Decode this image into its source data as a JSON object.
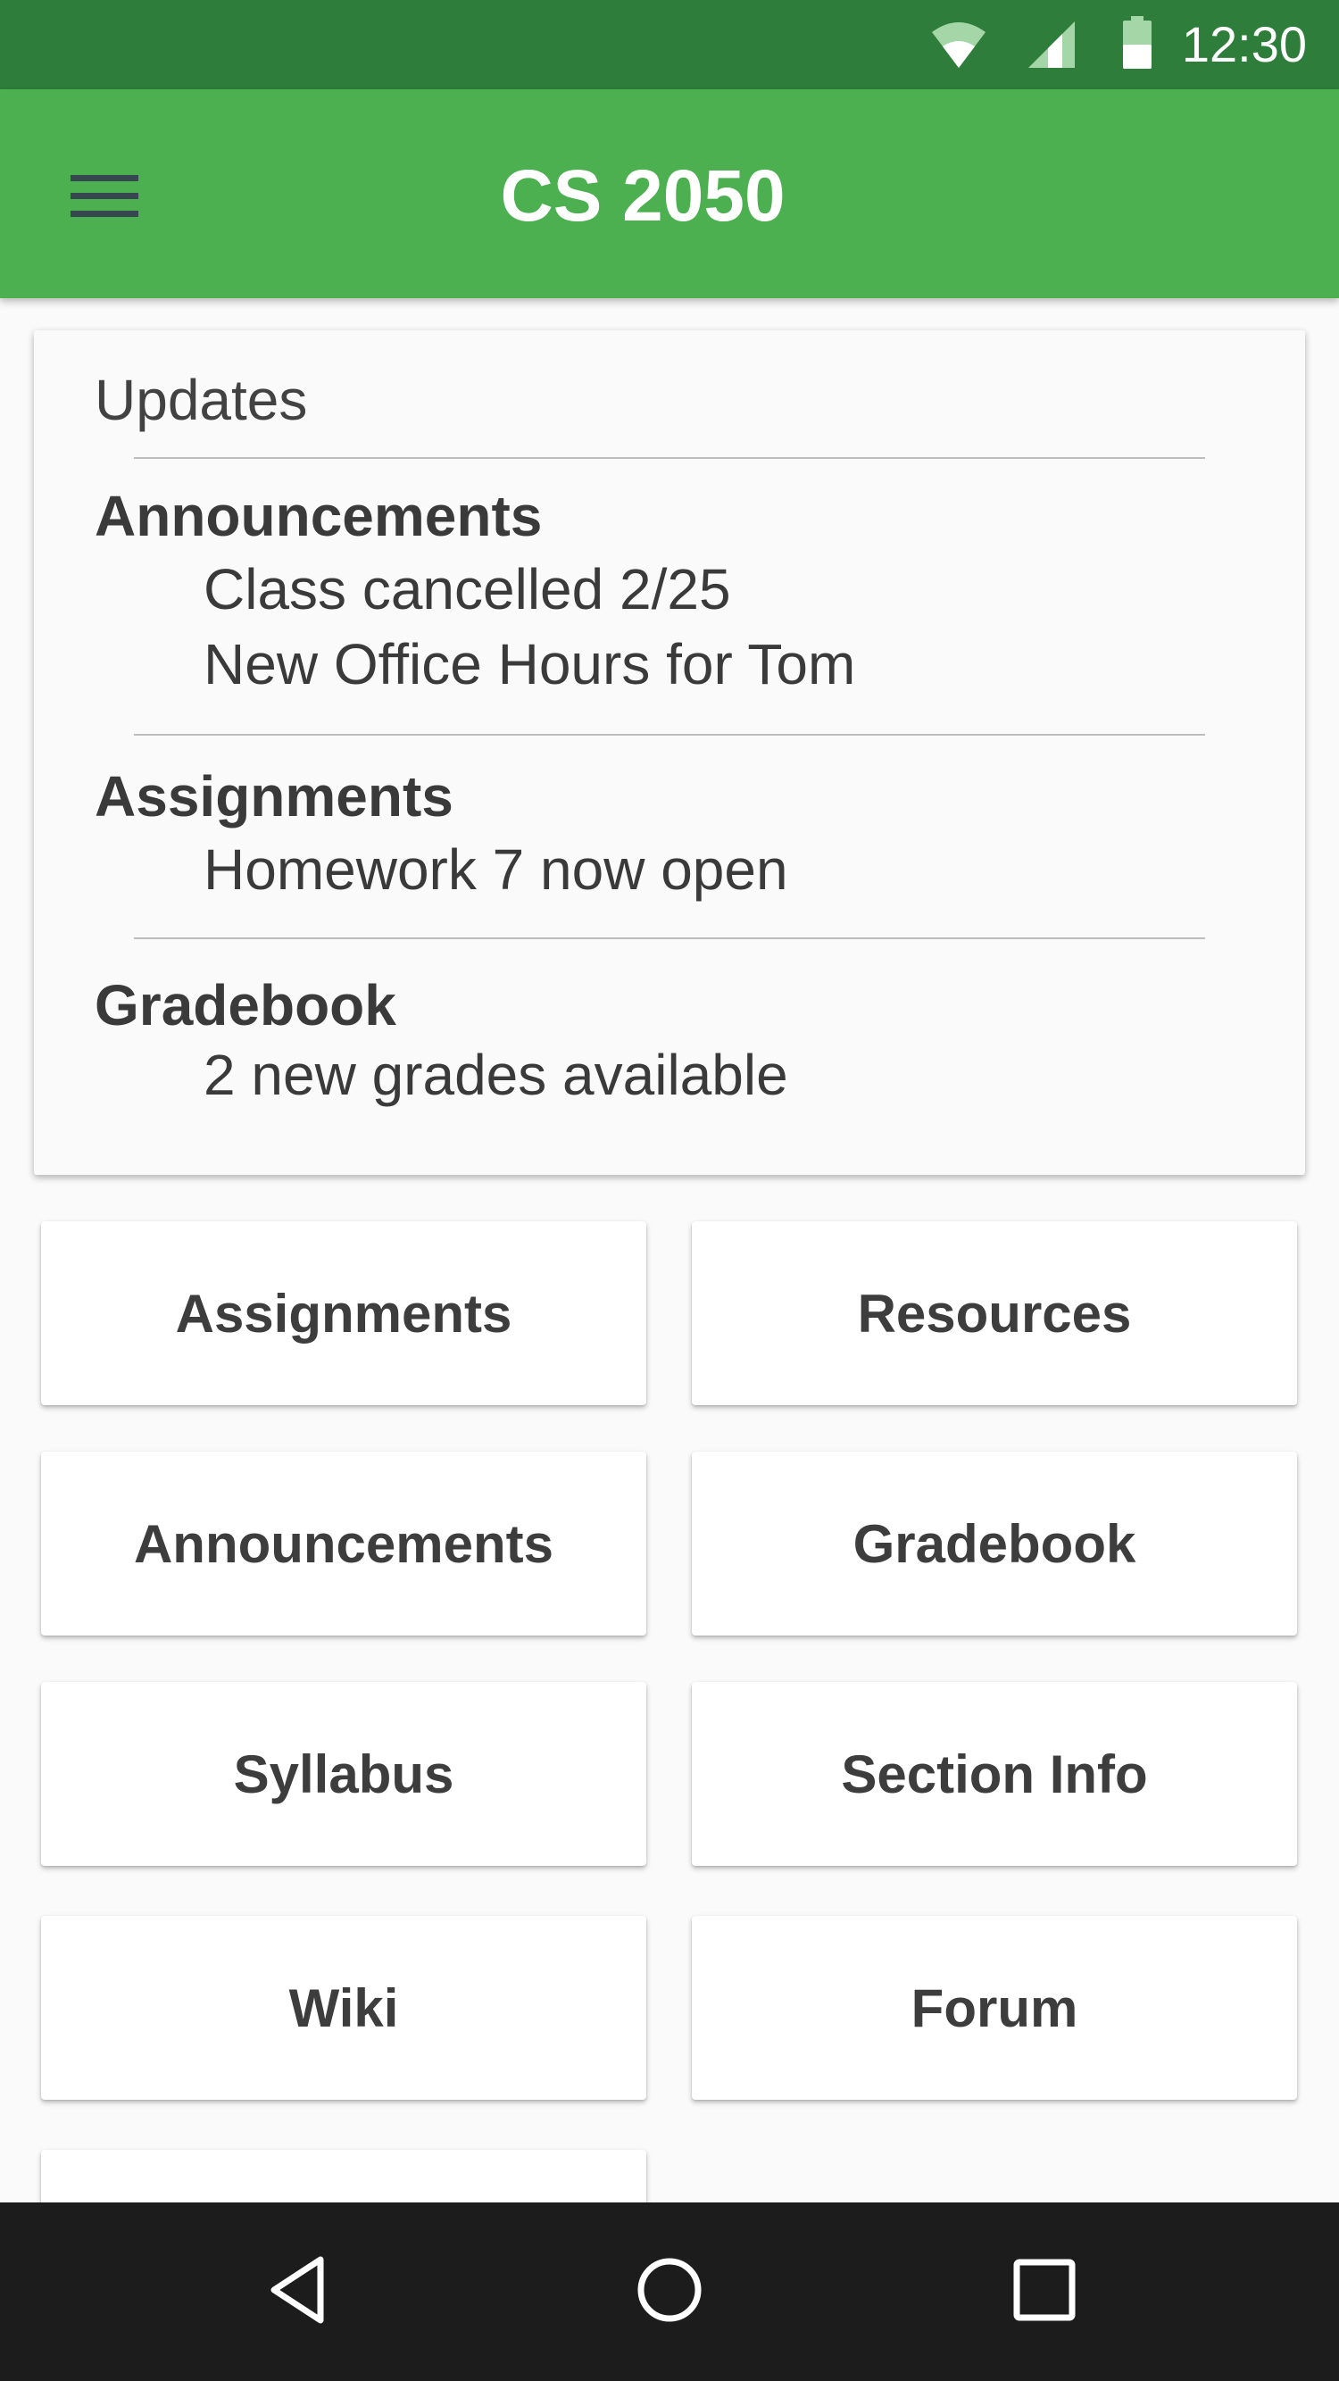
{
  "status_bar": {
    "time": "12:30",
    "icons": [
      "wifi-icon",
      "cellular-signal-icon",
      "battery-icon"
    ]
  },
  "app_bar": {
    "title": "CS 2050",
    "menu_icon": "hamburger-menu-icon"
  },
  "updates": {
    "title": "Updates",
    "sections": [
      {
        "title": "Announcements",
        "items": [
          "Class cancelled 2/25",
          "New Office Hours for Tom"
        ]
      },
      {
        "title": "Assignments",
        "items": [
          "Homework 7 now open"
        ]
      },
      {
        "title": "Gradebook",
        "items": [
          "2 new grades available"
        ]
      }
    ]
  },
  "grid": {
    "buttons": [
      "Assignments",
      "Resources",
      "Announcements",
      "Gradebook",
      "Syllabus",
      "Section Info",
      "Wiki",
      "Forum"
    ]
  },
  "nav_bar": {
    "icons": [
      "back-icon",
      "home-icon",
      "recents-icon"
    ]
  },
  "colors": {
    "status_bar": "#2e7d3a",
    "app_bar": "#4caf50",
    "background": "#fafafa",
    "nav_bar": "#1c1c1c",
    "text": "#3a3a3a"
  }
}
